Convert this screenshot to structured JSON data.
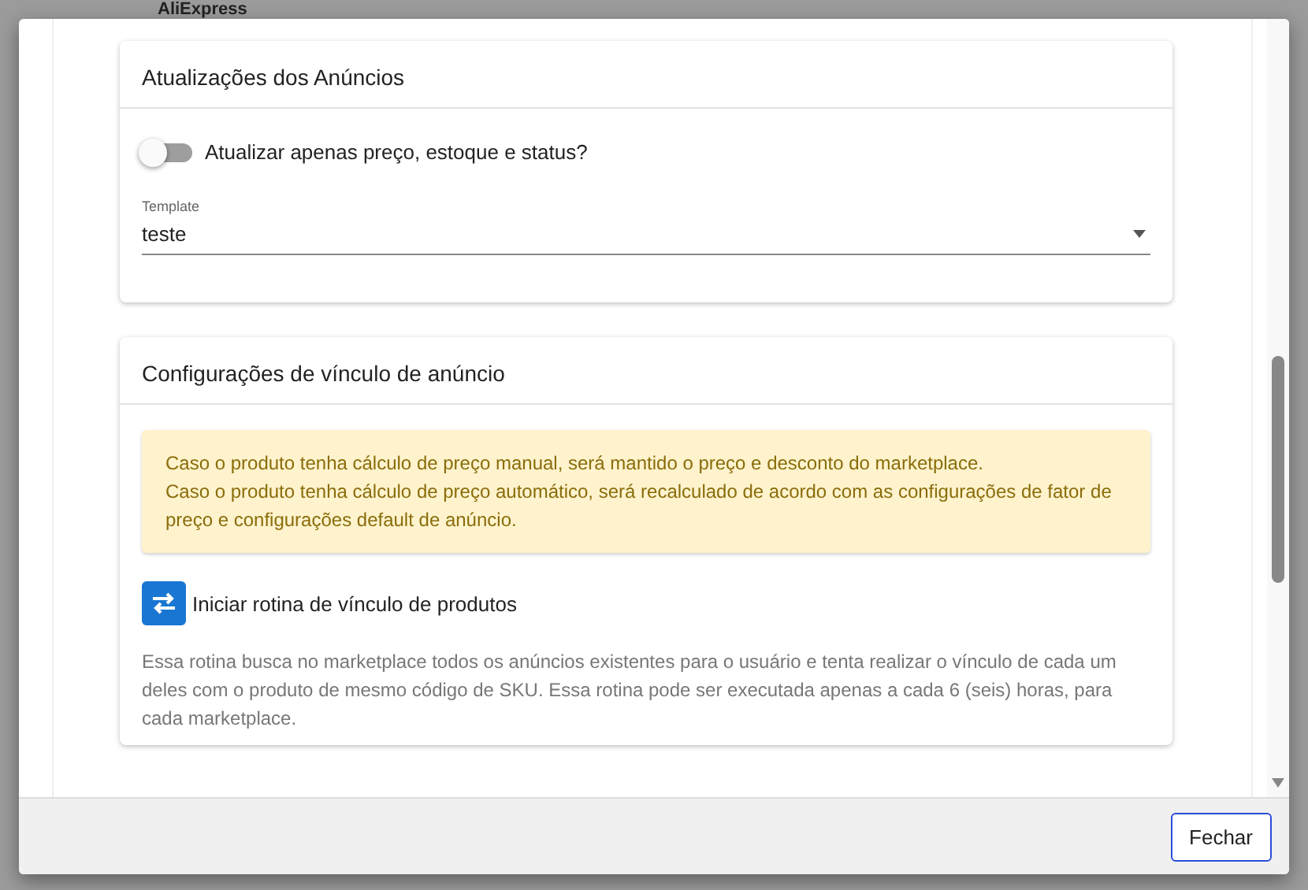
{
  "background": {
    "heading": "AliExpress"
  },
  "dialog": {
    "sections": [
      {
        "title": "Atualizações dos Anúncios",
        "toggle": {
          "label": "Atualizar apenas preço, estoque e status?",
          "on": false
        },
        "select": {
          "label": "Template",
          "value": "teste"
        }
      },
      {
        "title": "Configurações de vínculo de anúncio",
        "alert": [
          "Caso o produto tenha cálculo de preço manual, será mantido o preço e desconto do marketplace.",
          "Caso o produto tenha cálculo de preço automático, será recalculado de acordo com as configurações de fator de preço e configurações default de anúncio."
        ],
        "action": {
          "label": "Iniciar rotina de vínculo de produtos"
        },
        "description": "Essa rotina busca no marketplace todos os anúncios existentes para o usuário e tenta realizar o vínculo de cada um deles com o produto de mesmo código de SKU. Essa rotina pode ser executada apenas a cada 6 (seis) horas, para cada marketplace."
      }
    ],
    "buttons": [
      "Fechar"
    ]
  }
}
